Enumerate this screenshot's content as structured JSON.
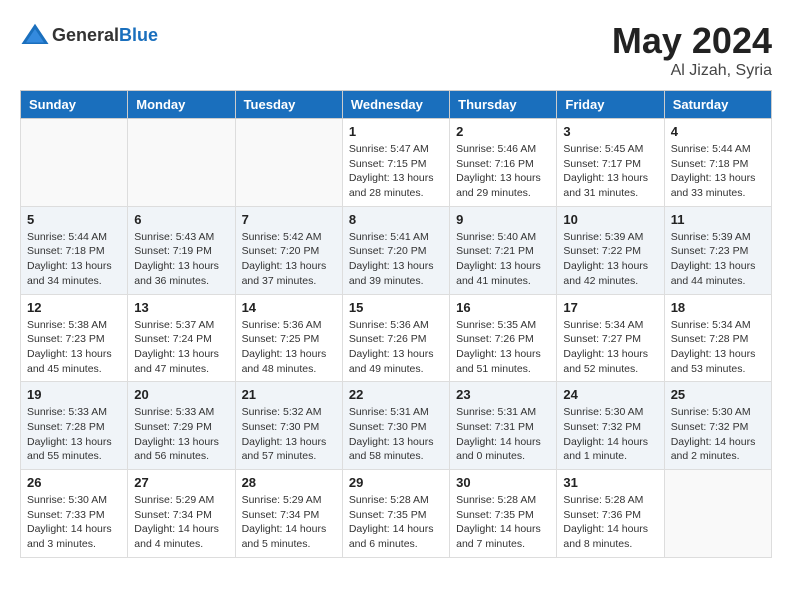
{
  "header": {
    "logo_general": "General",
    "logo_blue": "Blue",
    "month": "May 2024",
    "location": "Al Jizah, Syria"
  },
  "weekdays": [
    "Sunday",
    "Monday",
    "Tuesday",
    "Wednesday",
    "Thursday",
    "Friday",
    "Saturday"
  ],
  "weeks": [
    [
      {
        "day": "",
        "info": ""
      },
      {
        "day": "",
        "info": ""
      },
      {
        "day": "",
        "info": ""
      },
      {
        "day": "1",
        "info": "Sunrise: 5:47 AM\nSunset: 7:15 PM\nDaylight: 13 hours\nand 28 minutes."
      },
      {
        "day": "2",
        "info": "Sunrise: 5:46 AM\nSunset: 7:16 PM\nDaylight: 13 hours\nand 29 minutes."
      },
      {
        "day": "3",
        "info": "Sunrise: 5:45 AM\nSunset: 7:17 PM\nDaylight: 13 hours\nand 31 minutes."
      },
      {
        "day": "4",
        "info": "Sunrise: 5:44 AM\nSunset: 7:18 PM\nDaylight: 13 hours\nand 33 minutes."
      }
    ],
    [
      {
        "day": "5",
        "info": "Sunrise: 5:44 AM\nSunset: 7:18 PM\nDaylight: 13 hours\nand 34 minutes."
      },
      {
        "day": "6",
        "info": "Sunrise: 5:43 AM\nSunset: 7:19 PM\nDaylight: 13 hours\nand 36 minutes."
      },
      {
        "day": "7",
        "info": "Sunrise: 5:42 AM\nSunset: 7:20 PM\nDaylight: 13 hours\nand 37 minutes."
      },
      {
        "day": "8",
        "info": "Sunrise: 5:41 AM\nSunset: 7:20 PM\nDaylight: 13 hours\nand 39 minutes."
      },
      {
        "day": "9",
        "info": "Sunrise: 5:40 AM\nSunset: 7:21 PM\nDaylight: 13 hours\nand 41 minutes."
      },
      {
        "day": "10",
        "info": "Sunrise: 5:39 AM\nSunset: 7:22 PM\nDaylight: 13 hours\nand 42 minutes."
      },
      {
        "day": "11",
        "info": "Sunrise: 5:39 AM\nSunset: 7:23 PM\nDaylight: 13 hours\nand 44 minutes."
      }
    ],
    [
      {
        "day": "12",
        "info": "Sunrise: 5:38 AM\nSunset: 7:23 PM\nDaylight: 13 hours\nand 45 minutes."
      },
      {
        "day": "13",
        "info": "Sunrise: 5:37 AM\nSunset: 7:24 PM\nDaylight: 13 hours\nand 47 minutes."
      },
      {
        "day": "14",
        "info": "Sunrise: 5:36 AM\nSunset: 7:25 PM\nDaylight: 13 hours\nand 48 minutes."
      },
      {
        "day": "15",
        "info": "Sunrise: 5:36 AM\nSunset: 7:26 PM\nDaylight: 13 hours\nand 49 minutes."
      },
      {
        "day": "16",
        "info": "Sunrise: 5:35 AM\nSunset: 7:26 PM\nDaylight: 13 hours\nand 51 minutes."
      },
      {
        "day": "17",
        "info": "Sunrise: 5:34 AM\nSunset: 7:27 PM\nDaylight: 13 hours\nand 52 minutes."
      },
      {
        "day": "18",
        "info": "Sunrise: 5:34 AM\nSunset: 7:28 PM\nDaylight: 13 hours\nand 53 minutes."
      }
    ],
    [
      {
        "day": "19",
        "info": "Sunrise: 5:33 AM\nSunset: 7:28 PM\nDaylight: 13 hours\nand 55 minutes."
      },
      {
        "day": "20",
        "info": "Sunrise: 5:33 AM\nSunset: 7:29 PM\nDaylight: 13 hours\nand 56 minutes."
      },
      {
        "day": "21",
        "info": "Sunrise: 5:32 AM\nSunset: 7:30 PM\nDaylight: 13 hours\nand 57 minutes."
      },
      {
        "day": "22",
        "info": "Sunrise: 5:31 AM\nSunset: 7:30 PM\nDaylight: 13 hours\nand 58 minutes."
      },
      {
        "day": "23",
        "info": "Sunrise: 5:31 AM\nSunset: 7:31 PM\nDaylight: 14 hours\nand 0 minutes."
      },
      {
        "day": "24",
        "info": "Sunrise: 5:30 AM\nSunset: 7:32 PM\nDaylight: 14 hours\nand 1 minute."
      },
      {
        "day": "25",
        "info": "Sunrise: 5:30 AM\nSunset: 7:32 PM\nDaylight: 14 hours\nand 2 minutes."
      }
    ],
    [
      {
        "day": "26",
        "info": "Sunrise: 5:30 AM\nSunset: 7:33 PM\nDaylight: 14 hours\nand 3 minutes."
      },
      {
        "day": "27",
        "info": "Sunrise: 5:29 AM\nSunset: 7:34 PM\nDaylight: 14 hours\nand 4 minutes."
      },
      {
        "day": "28",
        "info": "Sunrise: 5:29 AM\nSunset: 7:34 PM\nDaylight: 14 hours\nand 5 minutes."
      },
      {
        "day": "29",
        "info": "Sunrise: 5:28 AM\nSunset: 7:35 PM\nDaylight: 14 hours\nand 6 minutes."
      },
      {
        "day": "30",
        "info": "Sunrise: 5:28 AM\nSunset: 7:35 PM\nDaylight: 14 hours\nand 7 minutes."
      },
      {
        "day": "31",
        "info": "Sunrise: 5:28 AM\nSunset: 7:36 PM\nDaylight: 14 hours\nand 8 minutes."
      },
      {
        "day": "",
        "info": ""
      }
    ]
  ]
}
